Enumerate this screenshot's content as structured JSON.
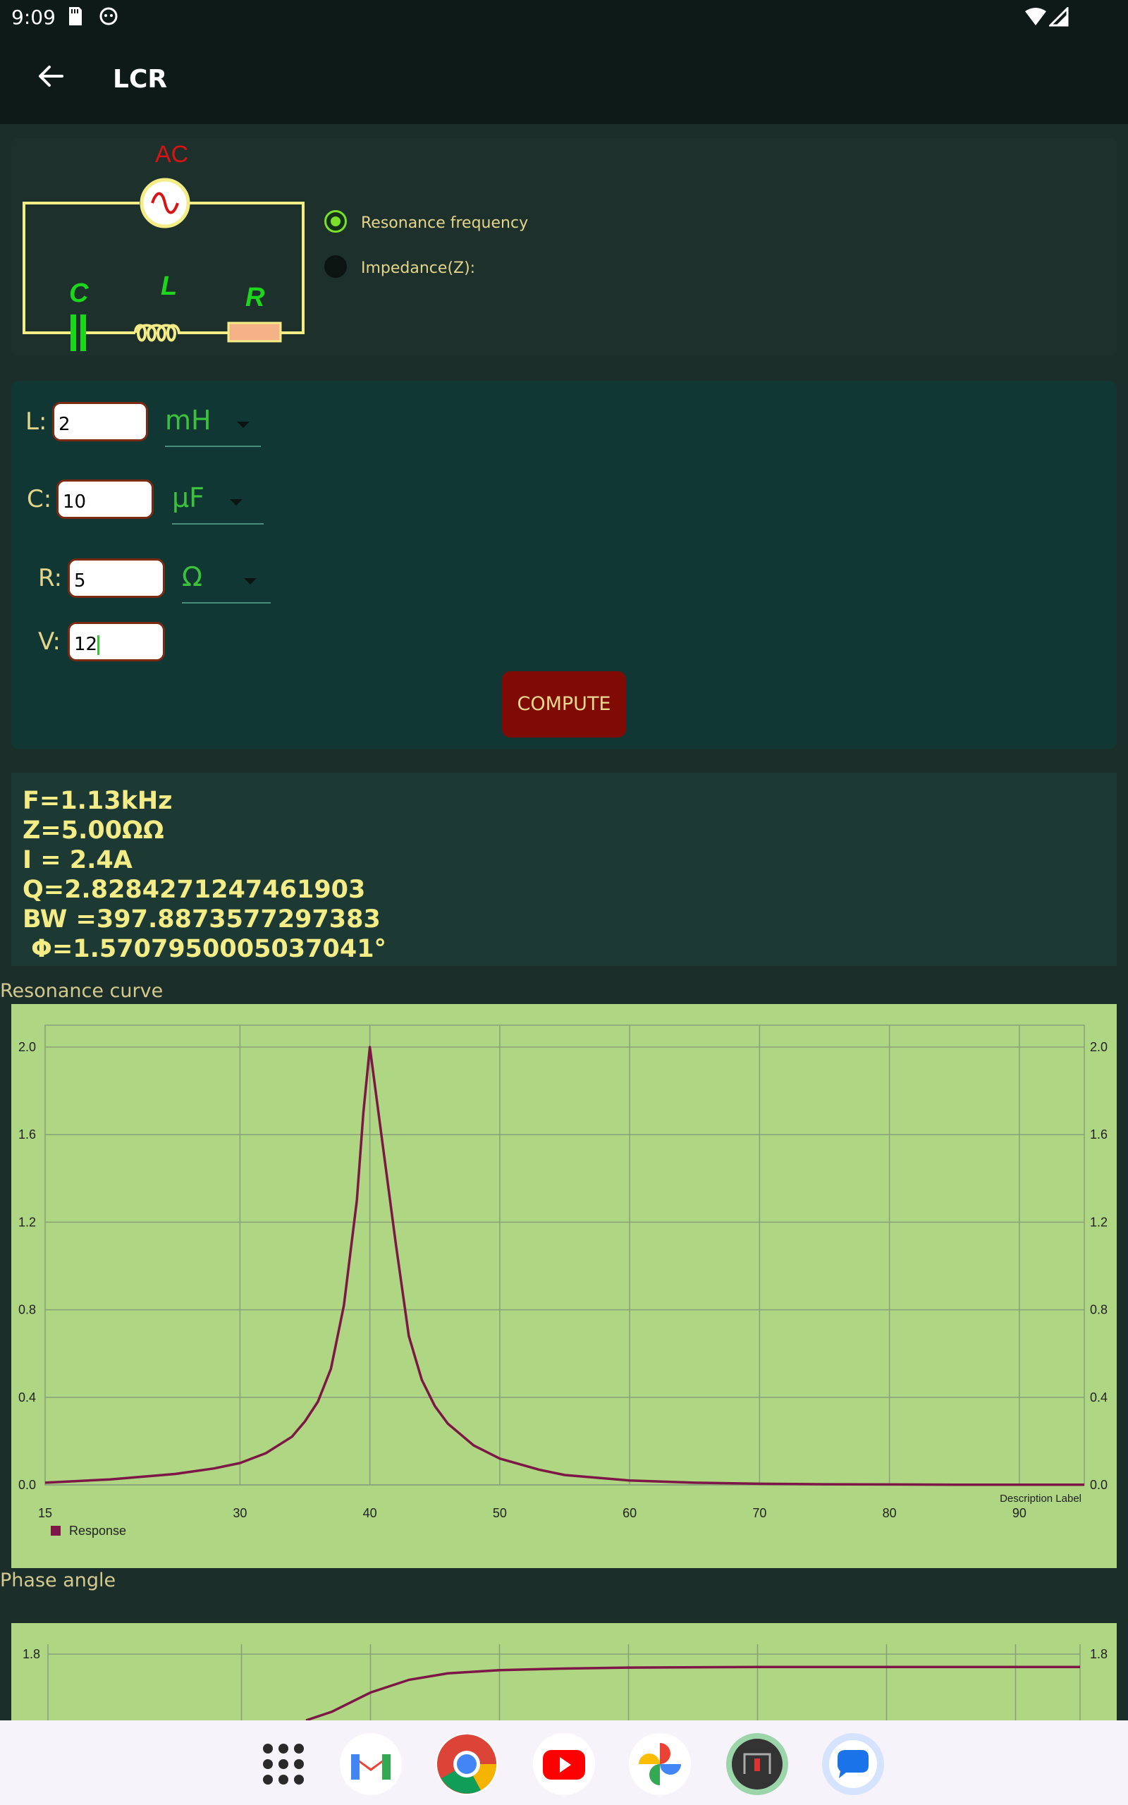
{
  "status": {
    "time": "9:09"
  },
  "appbar": {
    "title": "LCR"
  },
  "circuit": {
    "ac_label": "AC",
    "c_label": "C",
    "l_label": "L",
    "r_label": "R"
  },
  "mode_options": [
    {
      "label": "Resonance frequency",
      "selected": true
    },
    {
      "label": "Impedance(Z):",
      "selected": false
    }
  ],
  "inputs": {
    "L": {
      "label": "L:",
      "value": "2",
      "unit": "mH"
    },
    "C": {
      "label": "C:",
      "value": "10",
      "unit": "µF"
    },
    "R": {
      "label": "R:",
      "value": "5",
      "unit": "Ω"
    },
    "V": {
      "label": "V:",
      "value": "12"
    },
    "compute_label": "COMPUTE"
  },
  "results": [
    "F=1.13kHz",
    "Z=5.00ΩΩ",
    "I = 2.4A",
    "Q=2.8284271247461903",
    "BW =397.8873577297383",
    " Φ=1.5707950005037041°"
  ],
  "chart_data": [
    {
      "type": "line",
      "title": "Resonance curve",
      "description_label": "Description Label",
      "xlim": [
        15,
        95
      ],
      "ylim": [
        0,
        2.1
      ],
      "x_ticks": [
        15,
        30,
        40,
        50,
        60,
        70,
        80,
        90
      ],
      "y_ticks": [
        0.0,
        0.4,
        0.8,
        1.2,
        1.6,
        2.0
      ],
      "y_tick_labels": [
        "0.0",
        "0.4",
        "0.8",
        "1.2",
        "1.6",
        "2.0"
      ],
      "grid": true,
      "legend": "bottom-left",
      "colors": {
        "background": "#aed683",
        "line": "#7c1746",
        "grid": "#8aa07a"
      },
      "series": [
        {
          "name": "Response",
          "x": [
            15,
            20,
            25,
            28,
            30,
            32,
            34,
            35,
            36,
            37,
            38,
            39,
            39.5,
            40,
            41,
            42,
            43,
            44,
            45,
            46,
            48,
            50,
            53,
            55,
            60,
            65,
            70,
            75,
            80,
            85,
            90,
            95
          ],
          "y": [
            0.01,
            0.025,
            0.05,
            0.075,
            0.1,
            0.145,
            0.22,
            0.29,
            0.38,
            0.53,
            0.82,
            1.3,
            1.7,
            2.0,
            1.55,
            1.1,
            0.68,
            0.48,
            0.36,
            0.28,
            0.18,
            0.12,
            0.07,
            0.045,
            0.02,
            0.01,
            0.005,
            0.003,
            0.002,
            0.001,
            0.001,
            0.001
          ]
        }
      ]
    },
    {
      "type": "line",
      "title": "Phase angle",
      "xlim": [
        15,
        95
      ],
      "y_ticks": [
        1.8
      ],
      "y_tick_labels": [
        "1.8"
      ],
      "grid": true,
      "colors": {
        "background": "#aed683",
        "line": "#7c1746",
        "grid": "#8aa07a"
      },
      "series": [
        {
          "name": "",
          "x": [
            35,
            37,
            40,
            43,
            46,
            50,
            55,
            60,
            70,
            80,
            90,
            95
          ],
          "y": [
            1.55,
            1.62,
            1.68,
            1.72,
            1.74,
            1.75,
            1.755,
            1.758,
            1.76,
            1.76,
            1.76,
            1.76
          ]
        }
      ]
    }
  ],
  "dock_apps": [
    {
      "name": "app-drawer-icon"
    },
    {
      "name": "gmail-icon"
    },
    {
      "name": "chrome-icon"
    },
    {
      "name": "youtube-icon"
    },
    {
      "name": "photos-icon"
    },
    {
      "name": "lcr-app-icon"
    },
    {
      "name": "messages-icon"
    }
  ]
}
